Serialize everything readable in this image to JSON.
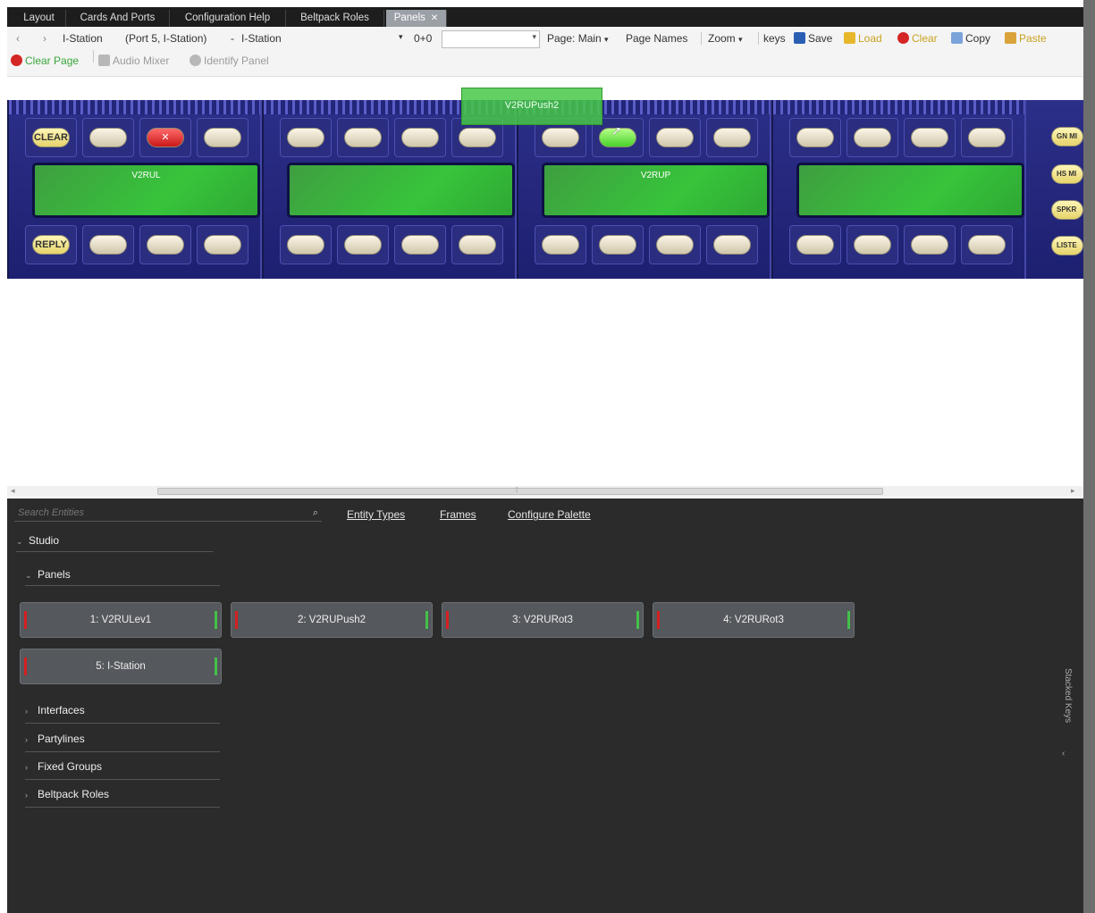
{
  "tabs": [
    {
      "label": "Layout"
    },
    {
      "label": "Cards And Ports"
    },
    {
      "label": "Configuration Help"
    },
    {
      "label": "Beltpack Roles"
    },
    {
      "label": "Panels",
      "active": true
    }
  ],
  "toolbar": {
    "back": "‹",
    "forward": "›",
    "station": "I-Station",
    "port": "(Port 5, I-Station)",
    "dash": "-",
    "station2": "I-Station",
    "dropdown_arrow": "▾",
    "offset": "0+0",
    "page": "Page: Main",
    "page_names": "Page Names",
    "zoom": "Zoom",
    "keys": "keys",
    "save": "Save",
    "load": "Load",
    "clear": "Clear",
    "copy": "Copy",
    "paste": "Paste",
    "clear_page": "Clear Page",
    "audio_mixer": "Audio Mixer",
    "identify_panel": "Identify Panel"
  },
  "canvas": {
    "drag_ghost": "V2RUPush2",
    "panels": [
      {
        "display": "V2RUL",
        "top_keys": [
          "CLEAR",
          "",
          "✕",
          ""
        ],
        "bottom_keys": [
          "REPLY",
          "",
          "",
          ""
        ]
      },
      {
        "display": "",
        "top_keys": [
          "",
          "",
          "",
          ""
        ],
        "bottom_keys": [
          "",
          "",
          "",
          ""
        ]
      },
      {
        "display": "V2RUP",
        "top_keys": [
          "",
          "",
          "",
          ""
        ],
        "bottom_keys": [
          "",
          "",
          "",
          ""
        ]
      },
      {
        "display": "",
        "top_keys": [
          "",
          "",
          "",
          ""
        ],
        "bottom_keys": [
          "",
          "",
          "",
          ""
        ]
      }
    ],
    "side_keys": [
      "GN MI",
      "HS MI",
      "SPKR C",
      "LISTE"
    ],
    "scroll_left": "◂",
    "scroll_right": "▸",
    "scroll_grip": "⁞"
  },
  "palette": {
    "search_placeholder": "Search Entities",
    "search_icon": "⌕",
    "links": [
      "Entity Types",
      "Frames",
      "Configure Palette"
    ],
    "studio": "Studio",
    "panels_group": "Panels",
    "tiles": [
      "1: V2RULev1",
      "2: V2RUPush2",
      "3: V2RURot3",
      "4: V2RURot3",
      "5: I-Station"
    ],
    "groups": [
      "Interfaces",
      "Partylines",
      "Fixed Groups",
      "Beltpack Roles"
    ],
    "stacked_keys": "Stacked Keys",
    "expanded_chevron": "⌄",
    "collapsed_chevron": "›"
  }
}
